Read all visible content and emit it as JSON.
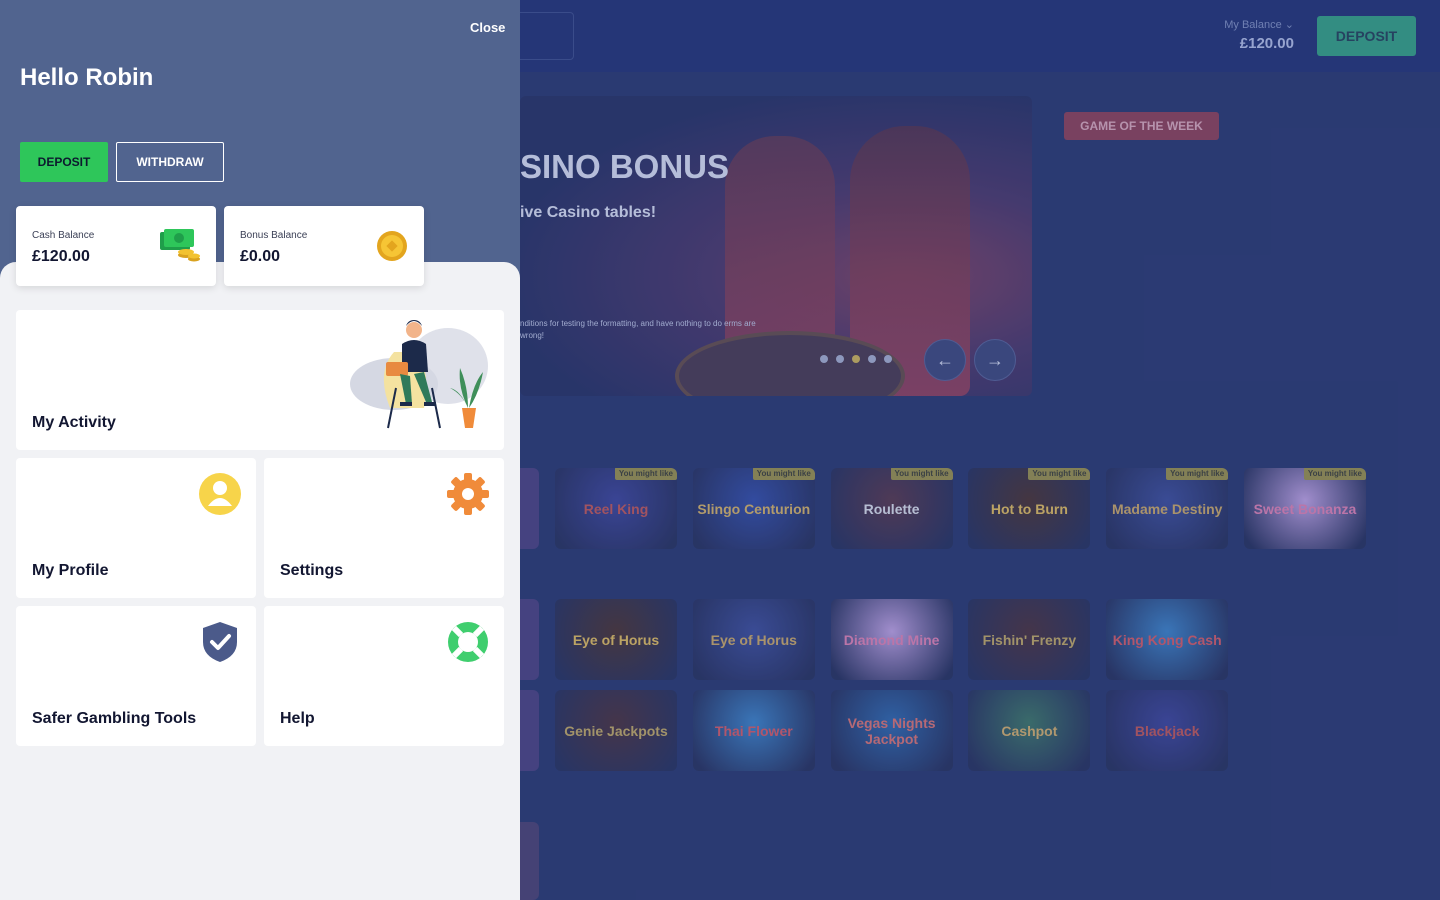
{
  "drawer": {
    "close_label": "Close",
    "greeting": "Hello Robin",
    "deposit_label": "DEPOSIT",
    "withdraw_label": "WITHDRAW",
    "cash_balance": {
      "label": "Cash Balance",
      "value": "£120.00"
    },
    "bonus_balance": {
      "label": "Bonus Balance",
      "value": "£0.00"
    },
    "tiles": {
      "activity": "My Activity",
      "profile": "My Profile",
      "settings": "Settings",
      "safer": "Safer Gambling Tools",
      "help": "Help"
    }
  },
  "header": {
    "balance_label": "My Balance",
    "balance_value": "£120.00",
    "deposit_label": "DEPOSIT"
  },
  "hero": {
    "title": "SINO BONUS",
    "subtitle": "ive Casino tables!",
    "small_text": "nditions for testing the formatting, and have nothing to do erms are wrong!",
    "active_slide": 3,
    "slide_count": 5
  },
  "game_of_week_label": "GAME OF THE WEEK",
  "games": {
    "tag": "You might like",
    "row1": [
      "Reel King",
      "Slingo Centurion",
      "Roulette",
      "Hot to Burn",
      "Madame Destiny",
      "Sweet Bonanza"
    ],
    "row2": [
      "Eye of Horus",
      "Eye of Horus",
      "Diamond Mine",
      "Fishin' Frenzy",
      "King Kong Cash"
    ],
    "row3": [
      "Genie Jackpots",
      "Thai Flower",
      "Vegas Nights Jackpot",
      "Cashpot",
      "Blackjack"
    ]
  },
  "colors": {
    "drawer_header": "#51648f",
    "deposit_green": "#2ec65a",
    "topbar": "#0a1a5c"
  }
}
